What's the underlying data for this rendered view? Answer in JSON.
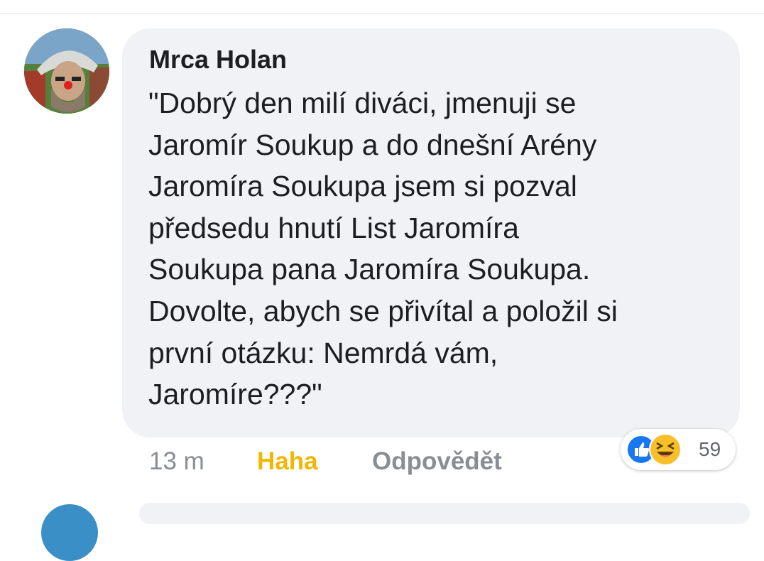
{
  "comment": {
    "author": "Mrca Holan",
    "text_lines": [
      "\"Dobrý den milí diváci, jmenuji se",
      "Jaromír Soukup a do dnešní Arény",
      "Jaromíra Soukupa jsem si pozval",
      "předsedu hnutí List Jaromíra",
      "Soukupa pana Jaromíra Soukupa.",
      "Dovolte, abych se přivítal a položil si",
      "první otázku: Nemrdá vám,",
      "Jaromíre???\""
    ],
    "timestamp": "13 m",
    "reaction_action": "Haha",
    "reply_action": "Odpovědět",
    "reaction_count": "59",
    "reaction_icons": [
      "like-icon",
      "haha-icon"
    ]
  },
  "colors": {
    "bubble_background": "#f0f2f5",
    "haha_action": "#f2b705",
    "like_blue": "#1877f2",
    "haha_yellow": "#f7c02b",
    "meta_gray": "#8a8d91"
  }
}
